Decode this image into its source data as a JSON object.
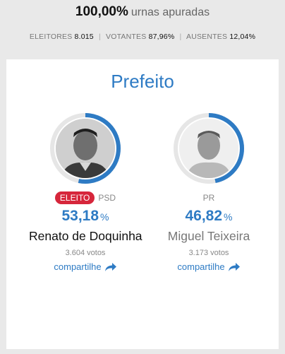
{
  "summary": {
    "percent": "100,00%",
    "percent_label": "urnas apuradas",
    "eleitores_label": "ELEITORES",
    "eleitores_value": "8.015",
    "votantes_label": "VOTANTES",
    "votantes_value": "87,96%",
    "ausentes_label": "AUSENTES",
    "ausentes_value": "12,04%",
    "separator": "|"
  },
  "office": "Prefeito",
  "candidates": [
    {
      "badge": "ELEITO",
      "party": "PSD",
      "percent": "53,18",
      "percent_unit": "%",
      "share_fraction": 0.5318,
      "name": "Renato de Doquinha",
      "votes": "3.604 votos",
      "share_label": "compartilhe",
      "ring_color": "#2e7bc4"
    },
    {
      "party": "PR",
      "percent": "46,82",
      "percent_unit": "%",
      "share_fraction": 0.4682,
      "name": "Miguel Teixeira",
      "votes": "3.173 votos",
      "share_label": "compartilhe",
      "ring_color": "#2e7bc4"
    }
  ]
}
